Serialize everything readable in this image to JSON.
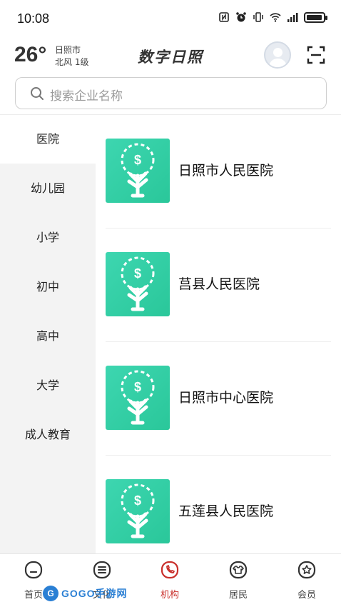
{
  "status_bar": {
    "time": "10:08",
    "icons": [
      "nfc-icon",
      "alarm-icon",
      "vibrate-icon",
      "wifi-icon",
      "signal-icon",
      "battery-icon"
    ]
  },
  "header": {
    "temperature": "26°",
    "city": "日照市",
    "wind": "北风  1级",
    "app_title": "数字日照",
    "avatar_icon": "avatar-icon",
    "scan_icon": "scan-icon"
  },
  "search": {
    "placeholder": "搜索企业名称",
    "icon": "search-icon"
  },
  "categories": [
    {
      "label": "医院",
      "active": true
    },
    {
      "label": "幼儿园",
      "active": false
    },
    {
      "label": "小学",
      "active": false
    },
    {
      "label": "初中",
      "active": false
    },
    {
      "label": "高中",
      "active": false
    },
    {
      "label": "大学",
      "active": false
    },
    {
      "label": "成人教育",
      "active": false
    }
  ],
  "institutions": [
    {
      "name": "日照市人民医院",
      "logo_icon": "money-tree-icon"
    },
    {
      "name": "莒县人民医院",
      "logo_icon": "money-tree-icon"
    },
    {
      "name": "日照市中心医院",
      "logo_icon": "money-tree-icon"
    },
    {
      "name": "五莲县人民医院",
      "logo_icon": "money-tree-icon"
    }
  ],
  "bottom_nav": [
    {
      "label": "首页",
      "icon": "home-face-icon",
      "active": false
    },
    {
      "label": "文化",
      "icon": "list-doc-icon",
      "active": false
    },
    {
      "label": "机构",
      "icon": "phone-circle-icon",
      "active": true
    },
    {
      "label": "居民",
      "icon": "shirt-icon",
      "active": false
    },
    {
      "label": "会员",
      "icon": "star-badge-icon",
      "active": false
    }
  ],
  "watermark": {
    "badge": "G",
    "text": "GOGO手游网"
  },
  "colors": {
    "accent": "#c9302c",
    "logo_green": "#2ac79a",
    "sidebar_bg": "#f3f3f3"
  }
}
